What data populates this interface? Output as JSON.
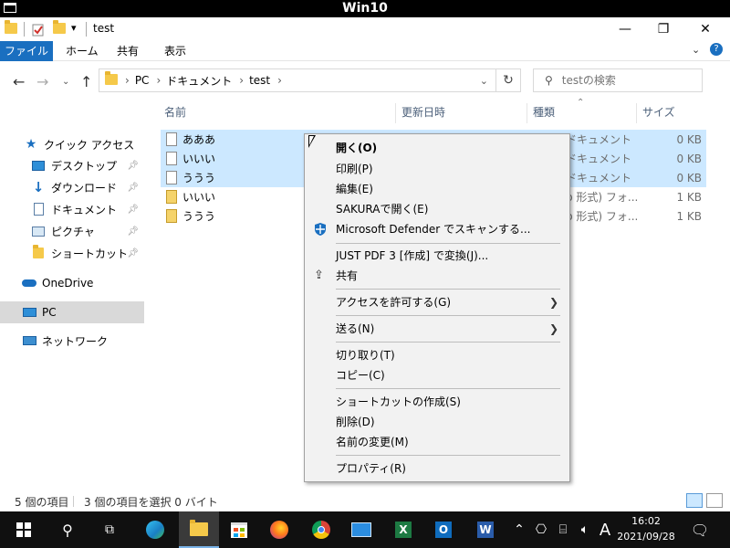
{
  "vm": {
    "title": "Win10"
  },
  "window": {
    "title": "test",
    "controls": {
      "minimize": "—",
      "maximize": "❐",
      "close": "✕"
    }
  },
  "ribbon": {
    "tabs": [
      "ファイル",
      "ホーム",
      "共有",
      "表示"
    ]
  },
  "address": {
    "crumbs": [
      "PC",
      "ドキュメント",
      "test"
    ],
    "search_placeholder": "testの検索"
  },
  "nav": {
    "quick_access": "クイック アクセス",
    "items": [
      {
        "label": "デスクトップ",
        "icon": "desktop-icon"
      },
      {
        "label": "ダウンロード",
        "icon": "download-icon"
      },
      {
        "label": "ドキュメント",
        "icon": "document-icon"
      },
      {
        "label": "ピクチャ",
        "icon": "pictures-icon"
      },
      {
        "label": "ショートカット",
        "icon": "folder-icon"
      }
    ],
    "onedrive": "OneDrive",
    "pc": "PC",
    "network": "ネットワーク"
  },
  "columns": {
    "name": "名前",
    "modified": "更新日時",
    "type": "種類",
    "size": "サイズ"
  },
  "files": [
    {
      "name": "あああ",
      "type": "ドキュメント",
      "size": "0 KB",
      "selected": true,
      "kind": "text"
    },
    {
      "name": "いいい",
      "type": "ドキュメント",
      "size": "0 KB",
      "selected": true,
      "kind": "text"
    },
    {
      "name": "ううう",
      "type": "ドキュメント",
      "size": "0 KB",
      "selected": true,
      "kind": "text"
    },
    {
      "name": "いいい",
      "type": "p 形式) フォ...",
      "size": "1 KB",
      "selected": false,
      "kind": "zip"
    },
    {
      "name": "ううう",
      "type": "p 形式) フォ...",
      "size": "1 KB",
      "selected": false,
      "kind": "zip"
    }
  ],
  "status": {
    "count": "5 個の項目",
    "selected": "3 個の項目を選択 0 バイト"
  },
  "context_menu": {
    "open": "開く(O)",
    "print": "印刷(P)",
    "edit": "編集(E)",
    "sakura": "SAKURAで開く(E)",
    "defender": "Microsoft Defender でスキャンする...",
    "justpdf": "JUST PDF 3 [作成] で変換(J)...",
    "share": "共有",
    "give_access": "アクセスを許可する(G)",
    "send_to": "送る(N)",
    "cut": "切り取り(T)",
    "copy": "コピー(C)",
    "shortcut": "ショートカットの作成(S)",
    "delete": "削除(D)",
    "rename": "名前の変更(M)",
    "properties": "プロパティ(R)"
  },
  "taskbar": {
    "ime": "A",
    "time": "16:02",
    "date": "2021/09/28"
  },
  "colors": {
    "accent": "#1a6fc0",
    "selection": "#cce8ff",
    "taskbar": "#101010"
  }
}
